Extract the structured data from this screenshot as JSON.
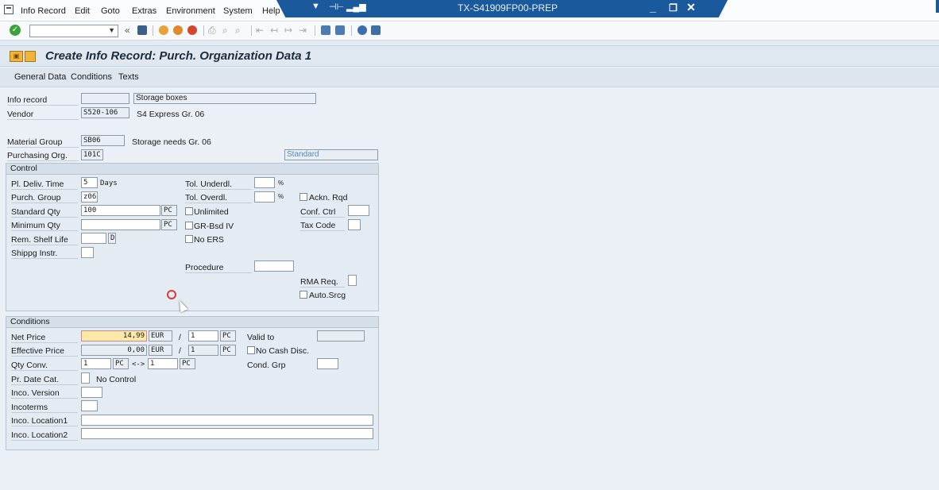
{
  "menu": {
    "items": [
      "Info Record",
      "Edit",
      "Goto",
      "Extras",
      "Environment",
      "System",
      "Help"
    ],
    "system_title": "TX-S41909FP00-PREP"
  },
  "toolbar": {
    "command_value": "",
    "back_glyph": "«"
  },
  "header": {
    "title": "Create Info Record: Purch. Organization Data 1"
  },
  "appbar": {
    "items": [
      "General Data",
      "Conditions",
      "Texts"
    ]
  },
  "top": {
    "info_record_label": "Info record",
    "info_record_value": "",
    "info_record_text": "Storage boxes",
    "vendor_label": "Vendor",
    "vendor_value": "S520-106",
    "vendor_text": "S4 Express Gr. 06",
    "material_group_label": "Material Group",
    "material_group_value": "SB06",
    "material_group_text": "Storage needs Gr. 06",
    "purch_org_label": "Purchasing Org.",
    "purch_org_value": "101C",
    "standard_value": "Standard"
  },
  "control": {
    "title": "Control",
    "pl_deliv_label": "Pl. Deliv. Time",
    "pl_deliv_value": "5",
    "pl_deliv_unit": "Days",
    "purch_group_label": "Purch. Group",
    "purch_group_value": "z06",
    "standard_qty_label": "Standard Qty",
    "standard_qty_value": "100",
    "standard_qty_unit": "PC",
    "minimum_qty_label": "Minimum Qty",
    "minimum_qty_value": "",
    "minimum_qty_unit": "PC",
    "rem_shelf_label": "Rem. Shelf Life",
    "rem_shelf_unit": "D",
    "shipping_label": "Shippg Instr.",
    "tol_under_label": "Tol. Underdl.",
    "tol_over_label": "Tol. Overdl.",
    "percent": "%",
    "unlimited_label": "Unlimited",
    "grbsd_label": "GR-Bsd IV",
    "noers_label": "No ERS",
    "procedure_label": "Procedure",
    "ackn_label": "Ackn. Rqd",
    "conf_ctrl_label": "Conf. Ctrl",
    "tax_code_label": "Tax Code",
    "rma_label": "RMA Req.",
    "auto_srcg_label": "Auto.Srcg"
  },
  "conditions": {
    "title": "Conditions",
    "net_price_label": "Net Price",
    "net_price_value": "14,99",
    "net_price_currency": "EUR",
    "per": "/",
    "net_per_qty": "1",
    "net_per_unit": "PC",
    "valid_to_label": "Valid to",
    "effective_price_label": "Effective Price",
    "effective_price_value": "0,00",
    "effective_currency": "EUR",
    "eff_per_qty": "1",
    "eff_per_unit": "PC",
    "no_cash_label": "No Cash Disc.",
    "qty_conv_label": "Qty Conv.",
    "qty_conv_left": "1",
    "qty_conv_left_unit": "PC",
    "qty_conv_arrow": "<->",
    "qty_conv_right": "1",
    "qty_conv_right_unit": "PC",
    "cond_grp_label": "Cond. Grp",
    "pr_date_label": "Pr. Date Cat.",
    "pr_date_text": "No Control",
    "inco_version_label": "Inco. Version",
    "incoterms_label": "Incoterms",
    "inco_loc1_label": "Inco. Location1",
    "inco_loc2_label": "Inco. Location2"
  }
}
